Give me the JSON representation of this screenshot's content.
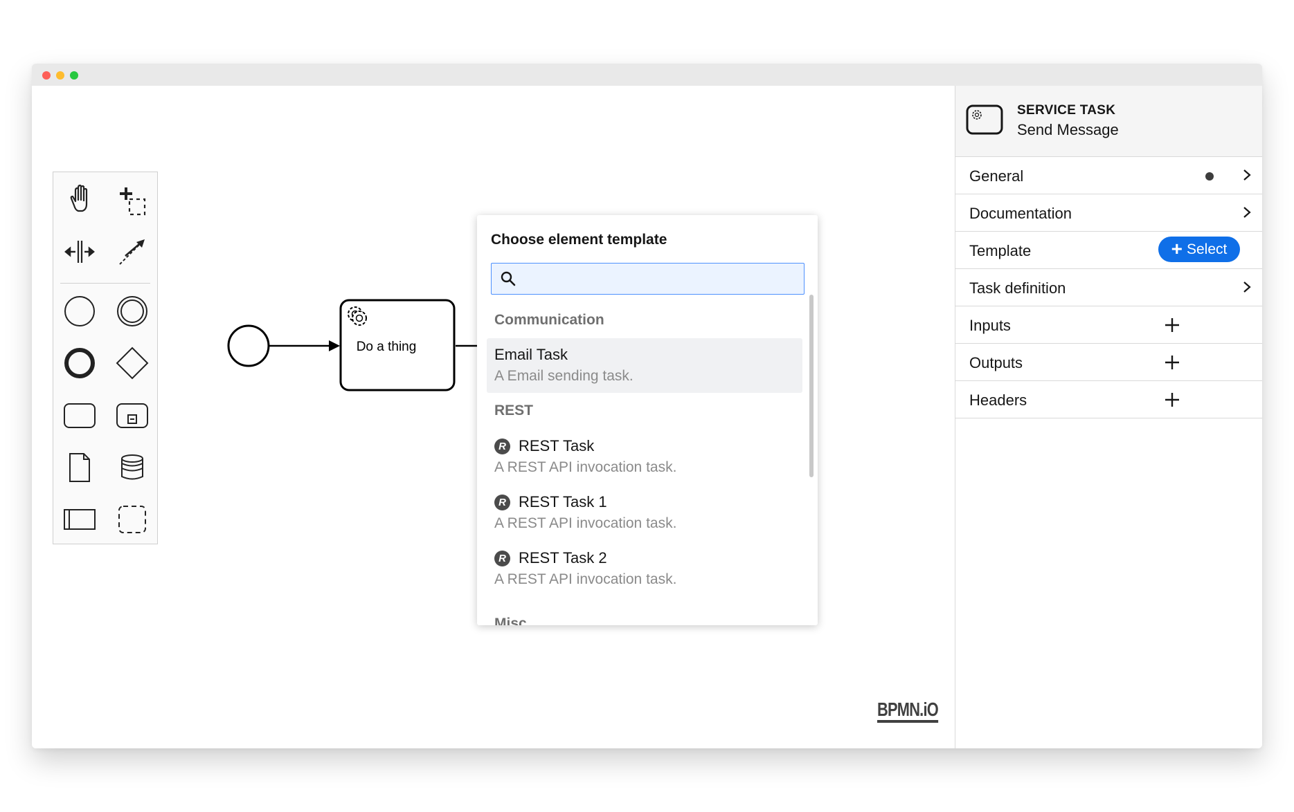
{
  "canvas": {
    "task_label": "Do a thing",
    "watermark": "BPMN.iO"
  },
  "palette": {
    "tools": [
      "hand-tool-icon",
      "lasso-tool-icon",
      "space-tool-icon",
      "global-connect-icon",
      "start-event-icon",
      "intermediate-event-icon",
      "end-event-icon",
      "gateway-icon",
      "task-icon",
      "subprocess-icon",
      "data-object-icon",
      "data-store-icon",
      "participant-icon",
      "group-icon"
    ]
  },
  "popup": {
    "title": "Choose element template",
    "search_placeholder": "",
    "groups": [
      {
        "title": "Communication",
        "entries": [
          {
            "name": "Email Task",
            "description": "A Email sending task."
          }
        ]
      },
      {
        "title": "REST",
        "entries": [
          {
            "name": "REST Task",
            "description": "A REST API invocation task."
          },
          {
            "name": "REST Task 1",
            "description": "A REST API invocation task."
          },
          {
            "name": "REST Task 2",
            "description": "A REST API invocation task."
          }
        ]
      },
      {
        "title": "Misc",
        "entries": []
      }
    ]
  },
  "panel": {
    "header": {
      "type": "SERVICE TASK",
      "name": "Send Message"
    },
    "groups": [
      {
        "label": "General"
      },
      {
        "label": "Documentation"
      },
      {
        "label": "Template",
        "button": "Select"
      },
      {
        "label": "Task definition"
      },
      {
        "label": "Inputs"
      },
      {
        "label": "Outputs"
      },
      {
        "label": "Headers"
      }
    ]
  },
  "colors": {
    "accent": "#0f6fe8",
    "search_bg": "#ebf3ff",
    "search_border": "#4d90fe"
  }
}
